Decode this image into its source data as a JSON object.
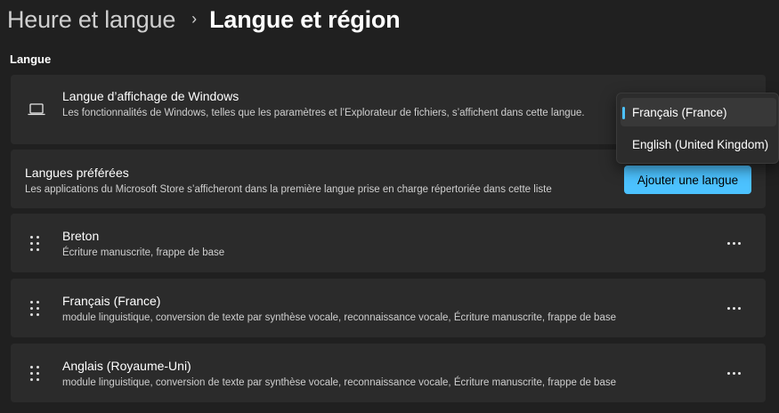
{
  "breadcrumb": {
    "parent": "Heure et langue",
    "separator": "›",
    "current": "Langue et région"
  },
  "section": {
    "title": "Langue"
  },
  "display_language": {
    "icon": "laptop-icon",
    "title": "Langue d’affichage de Windows",
    "description": "Les fonctionnalités de Windows, telles que les paramètres et l’Explorateur de fichiers, s’affichent dans cette langue.",
    "dropdown": {
      "options": [
        "Français (France)",
        "English (United Kingdom)"
      ],
      "selected_index": 0
    }
  },
  "preferred_languages": {
    "title": "Langues préférées",
    "description": "Les applications du Microsoft Store s’afficheront dans la première langue prise en charge répertoriée dans cette liste",
    "add_button_label": "Ajouter une langue"
  },
  "languages": [
    {
      "name": "Breton",
      "features": "Écriture manuscrite, frappe de base"
    },
    {
      "name": "Français (France)",
      "features": "module linguistique, conversion de texte par synthèse vocale, reconnaissance vocale, Écriture manuscrite, frappe de base"
    },
    {
      "name": "Anglais (Royaume-Uni)",
      "features": "module linguistique, conversion de texte par synthèse vocale, reconnaissance vocale, Écriture manuscrite, frappe de base"
    }
  ],
  "colors": {
    "background": "#202020",
    "card": "#2b2b2b",
    "accent": "#4cc2ff",
    "text_primary": "#ffffff",
    "text_secondary": "#cfcfcf"
  }
}
